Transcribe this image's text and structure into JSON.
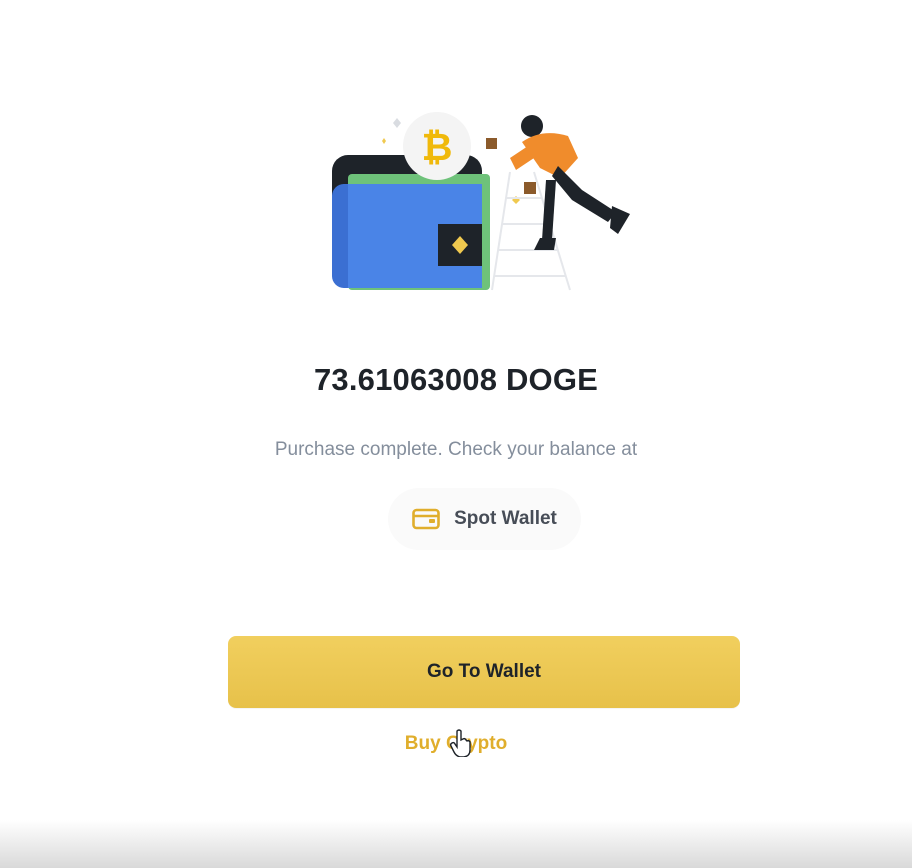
{
  "result": {
    "amount": "73.61063008 DOGE",
    "message": "Purchase complete. Check your balance at",
    "wallet_chip_label": "Spot Wallet",
    "primary_button_label": "Go To Wallet",
    "secondary_link_label": "Buy Crypto"
  },
  "icons": {
    "illustration": "wallet-illustration",
    "wallet": "wallet-icon",
    "cursor": "hand-cursor-icon"
  },
  "colors": {
    "accent": "#F0C94F",
    "link": "#E0AE2C",
    "text_primary": "#1E2329",
    "text_secondary": "#848E9C"
  }
}
